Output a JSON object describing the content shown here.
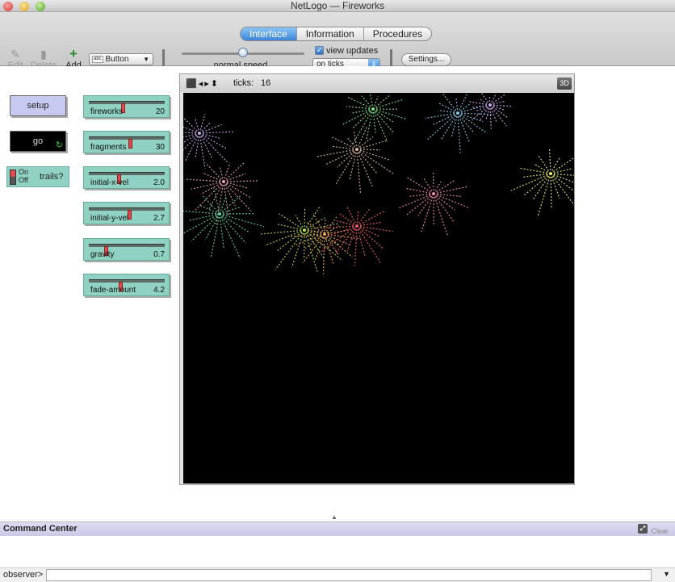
{
  "window": {
    "title": "NetLogo — Fireworks"
  },
  "tabs": [
    "Interface",
    "Information",
    "Procedures"
  ],
  "toolbar": {
    "edit_label": "Edit",
    "delete_label": "Delete",
    "add_label": "Add",
    "widget_type": "Button",
    "widget_type_icon": "abc",
    "speed_label": "normal speed",
    "speed_level": 0.5,
    "view_updates_label": "view updates",
    "view_updates_checked": true,
    "update_mode": "on ticks",
    "settings_label": "Settings..."
  },
  "buttons": {
    "setup": "setup",
    "go": "go"
  },
  "switch": {
    "on": "On",
    "off": "Off",
    "label": "trails?",
    "state": "off"
  },
  "sliders": [
    {
      "name": "fireworks",
      "value": "20",
      "fraction": 0.46
    },
    {
      "name": "fragments",
      "value": "30",
      "fraction": 0.56
    },
    {
      "name": "initial-x-vel",
      "value": "2.0",
      "fraction": 0.4
    },
    {
      "name": "initial-y-vel",
      "value": "2.7",
      "fraction": 0.55
    },
    {
      "name": "gravity",
      "value": "0.7",
      "fraction": 0.22
    },
    {
      "name": "fade-amount",
      "value": "4.2",
      "fraction": 0.42
    }
  ],
  "view": {
    "ticks_label": "ticks:",
    "ticks_value": "16",
    "three_d_label": "3D"
  },
  "command_center": {
    "title": "Command Center",
    "clear_label": "Clear",
    "prompt": "observer>"
  },
  "colors": {
    "accent": "#3c86d8",
    "slider_bg": "#8fd1c2",
    "setup_bg": "#c7c9f0",
    "knob": "#e24b4b"
  }
}
